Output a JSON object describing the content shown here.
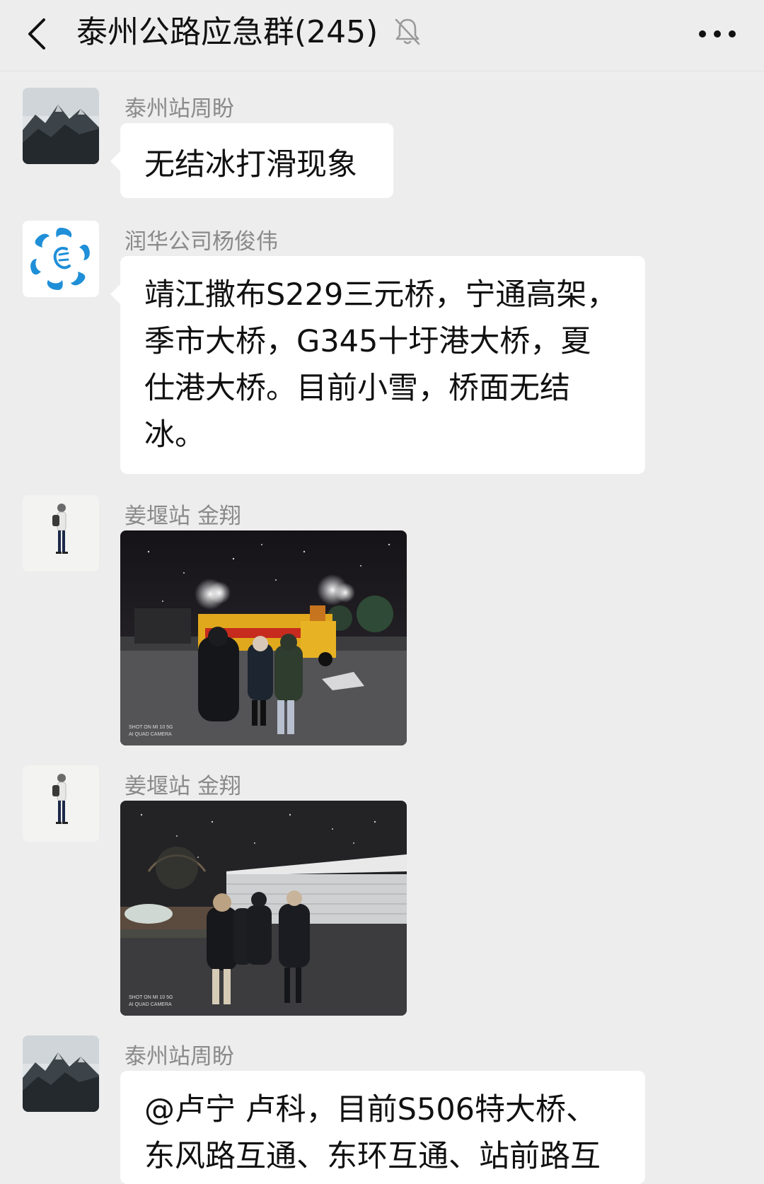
{
  "header": {
    "title": "泰州公路应急群(245)",
    "back_icon": "chevron-left-icon",
    "mute_icon": "bell-off-icon",
    "more_icon": "more-dots-icon"
  },
  "messages": [
    {
      "sender": "泰州站周盼",
      "type": "text",
      "text": "无结冰打滑现象",
      "avatar": "mountain-avatar"
    },
    {
      "sender": "润华公司杨俊伟",
      "type": "text",
      "text": "靖江撒布S229三元桥，宁通高架，季市大桥，G345十圩港大桥，夏仕港大桥。目前小雪，桥面无结冰。",
      "avatar": "blue-swirl-logo-avatar"
    },
    {
      "sender": "姜堰站 金翔",
      "type": "image",
      "image_desc": "night-snow-truck-photo",
      "avatar": "person-illustration-avatar"
    },
    {
      "sender": "姜堰站 金翔",
      "type": "image",
      "image_desc": "night-snow-building-photo",
      "avatar": "person-illustration-avatar"
    },
    {
      "sender": "泰州站周盼",
      "type": "text",
      "text": "@卢宁 卢科，目前S506特大桥、东风路互通、东环互通、站前路互",
      "avatar": "mountain-avatar"
    }
  ],
  "colors": {
    "background": "#ededed",
    "bubble": "#ffffff",
    "sender_name": "#8a8a8a",
    "text": "#111111"
  }
}
